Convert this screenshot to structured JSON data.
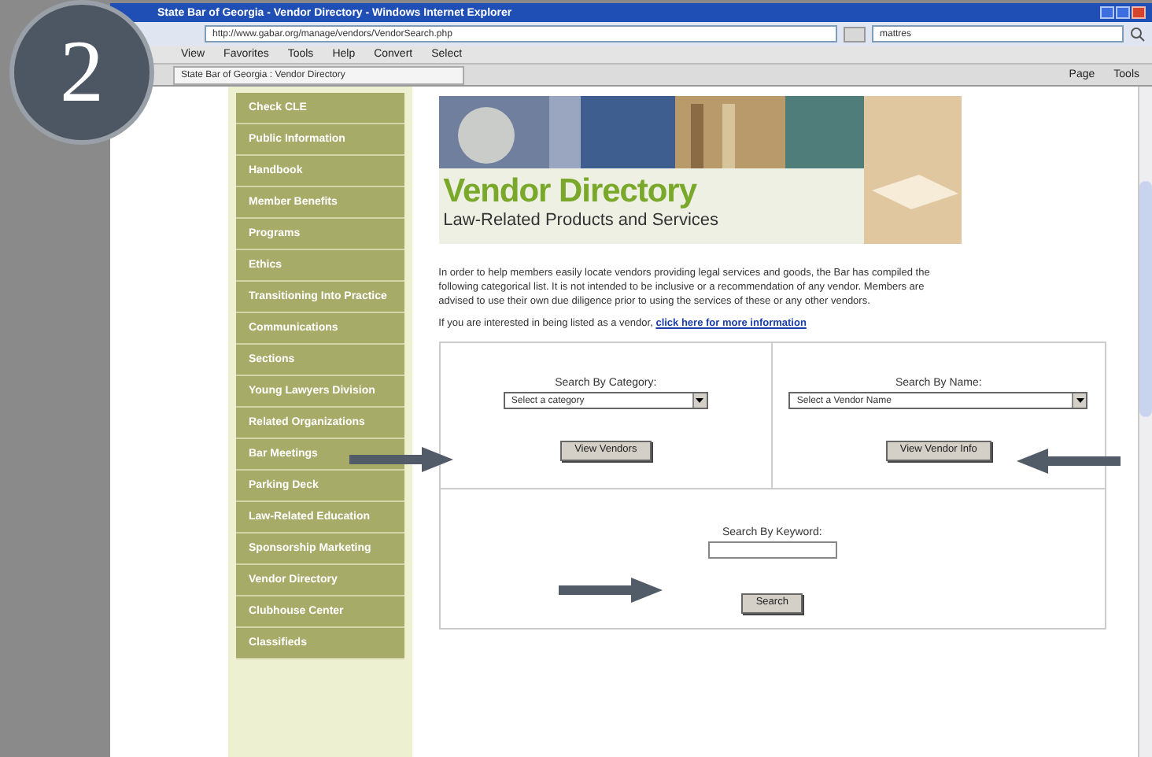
{
  "badge": "2",
  "window": {
    "title": "State Bar of Georgia - Vendor Directory - Windows Internet Explorer"
  },
  "address_bar": {
    "url": "http://www.gabar.org/manage/vendors/VendorSearch.php",
    "search": "mattres"
  },
  "menu": [
    "View",
    "Favorites",
    "Tools",
    "Help"
  ],
  "toolbar": [
    "Convert",
    "Select"
  ],
  "tab": {
    "label": "State Bar of Georgia : Vendor Directory"
  },
  "command_bar": [
    "Page",
    "Tools"
  ],
  "sidebar": {
    "items": [
      "Check CLE",
      "Public Information",
      "Handbook",
      "Member Benefits",
      "Programs",
      "Ethics",
      "Transitioning Into Practice",
      "Communications",
      "Sections",
      "Young Lawyers Division",
      "Related Organizations",
      "Bar Meetings",
      "Parking Deck",
      "Law-Related Education",
      "Sponsorship Marketing",
      "Vendor Directory",
      "Clubhouse Center",
      "Classifieds"
    ]
  },
  "banner": {
    "title": "Vendor Directory",
    "subtitle": "Law-Related Products and Services"
  },
  "intro": "In order to help members easily locate vendors providing legal services and goods, the Bar has compiled the following categorical list. It is not intended to be inclusive or a recommendation of any vendor. Members are advised to use their own due diligence prior to using the services of these or any other vendors.",
  "listing_note": {
    "text": "If you are interested in being listed as a vendor,",
    "link": "click here for more information"
  },
  "category_search": {
    "label": "Search By Category:",
    "value": "Select a category",
    "button": "View Vendors"
  },
  "name_search": {
    "label": "Search By Name:",
    "value": "Select a Vendor Name",
    "button": "View Vendor Info"
  },
  "keyword_search": {
    "label": "Search By Keyword:",
    "button": "Search"
  }
}
